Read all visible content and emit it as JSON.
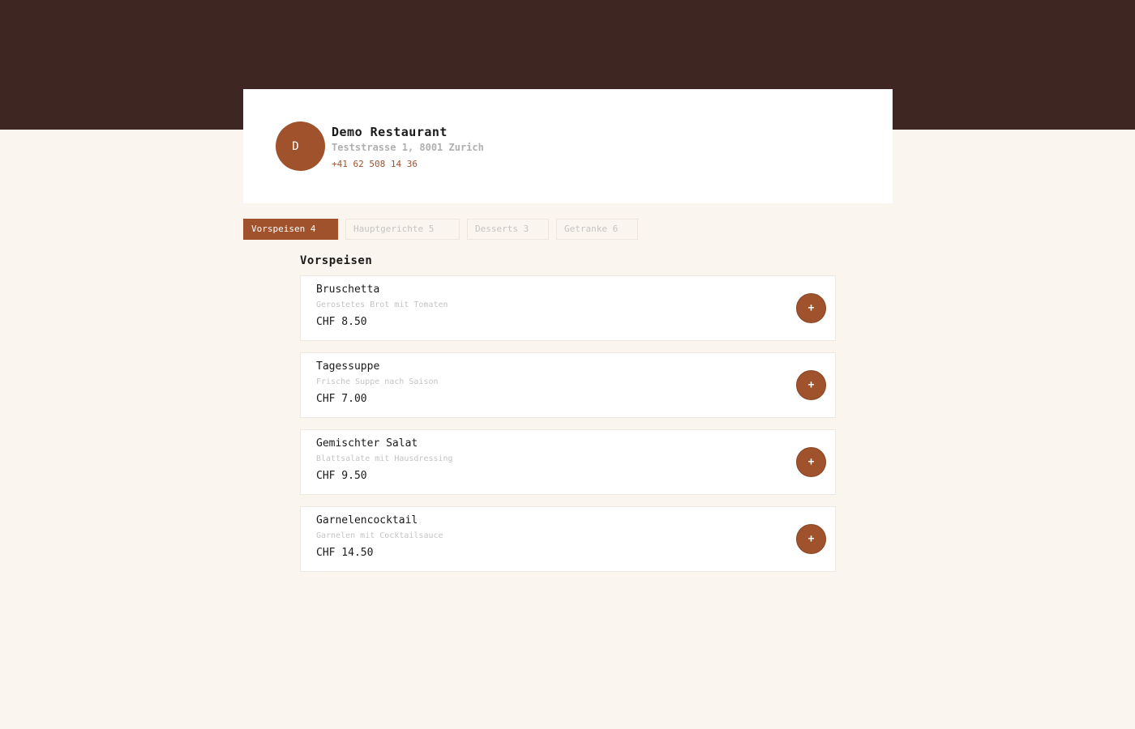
{
  "restaurant": {
    "initial": "D",
    "name": "Demo Restaurant",
    "address": "Teststrasse 1, 8001 Zurich",
    "phone": "+41 62 508 14 36"
  },
  "tabs": [
    {
      "label": "Vorspeisen 4",
      "active": true
    },
    {
      "label": "Hauptgerichte 5",
      "active": false
    },
    {
      "label": "Desserts 3",
      "active": false
    },
    {
      "label": "Getranke 6",
      "active": false
    }
  ],
  "section": {
    "title": "Vorspeisen"
  },
  "items": [
    {
      "name": "Bruschetta",
      "description": "Gerostetes Brot mit Tomaten",
      "price": "CHF 8.50",
      "add_label": "+"
    },
    {
      "name": "Tagessuppe",
      "description": "Frische Suppe nach Saison",
      "price": "CHF 7.00",
      "add_label": "+"
    },
    {
      "name": "Gemischter Salat",
      "description": "Blattsalate mit Hausdressing",
      "price": "CHF 9.50",
      "add_label": "+"
    },
    {
      "name": "Garnelencocktail",
      "description": "Garnelen mit Cocktailsauce",
      "price": "CHF 14.50",
      "add_label": "+"
    }
  ],
  "colors": {
    "header_band": "#3e2723",
    "accent": "#a0522d",
    "page_background": "#faf5ef"
  }
}
